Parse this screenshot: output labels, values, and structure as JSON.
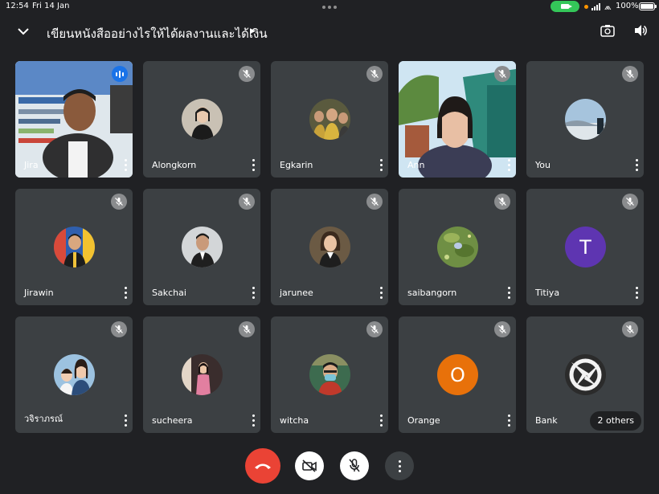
{
  "status_bar": {
    "time": "12:54",
    "date": "Fri 14 Jan",
    "battery": "100%",
    "wifi_glyph": "⩕"
  },
  "header": {
    "meeting_title": "เขียนหนังสืออย่างไรให้ได้ผลงานและได้เงิน",
    "caret": "▶"
  },
  "participants": [
    {
      "name": "Jira",
      "type": "video",
      "speaking": true,
      "muted": false
    },
    {
      "name": "Alongkorn",
      "type": "photo",
      "muted": true,
      "avatar_color": "#c9c1b4"
    },
    {
      "name": "Egkarin",
      "type": "photo",
      "muted": true,
      "avatar_color": "#6b6b4d"
    },
    {
      "name": "Ann",
      "type": "video",
      "muted": true
    },
    {
      "name": "You",
      "type": "photo",
      "muted": true,
      "avatar_color": "#a6c4dd"
    },
    {
      "name": "Jirawin",
      "type": "photo",
      "muted": true,
      "avatar_color": "#d94a3a"
    },
    {
      "name": "Sakchai",
      "type": "photo",
      "muted": true,
      "avatar_color": "#cfd2d4"
    },
    {
      "name": "jarunee",
      "type": "photo",
      "muted": true,
      "avatar_color": "#5e5246"
    },
    {
      "name": "saibangorn",
      "type": "photo",
      "muted": true,
      "avatar_color": "#7a9a4c"
    },
    {
      "name": "Titiya",
      "type": "initial",
      "initial": "T",
      "muted": true,
      "avatar_color": "#5e35b1"
    },
    {
      "name": "วจิราภรณ์",
      "type": "photo",
      "muted": true,
      "avatar_color": "#8fb7d9"
    },
    {
      "name": "sucheera",
      "type": "photo",
      "muted": true,
      "avatar_color": "#4a3b3b"
    },
    {
      "name": "witcha",
      "type": "photo",
      "muted": true,
      "avatar_color": "#3d6b4f"
    },
    {
      "name": "Orange",
      "type": "initial",
      "initial": "O",
      "muted": true,
      "avatar_color": "#e8710a"
    },
    {
      "name": "Bank",
      "type": "logo",
      "muted": true,
      "avatar_color": "#2b2b2b",
      "others_label": "2 others"
    }
  ],
  "controls": {
    "end_call_color": "#ea4335",
    "icons": [
      "end-call-icon",
      "camera-off-icon",
      "mic-off-icon",
      "more-options-icon"
    ]
  }
}
